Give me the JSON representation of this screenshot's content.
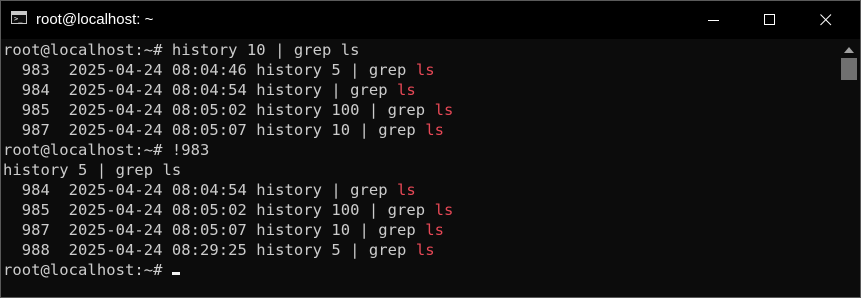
{
  "window": {
    "title": "root@localhost: ~"
  },
  "icons": {
    "app": "terminal-icon",
    "minimize": "minimize-icon",
    "maximize": "maximize-icon",
    "close": "close-icon",
    "scroll_up": "chevron-up-icon"
  },
  "colors": {
    "background": "#0c0c0c",
    "text": "#cccccc",
    "match_highlight": "#e74856",
    "titlebar": "#000000"
  },
  "terminal": {
    "lines": [
      {
        "text": "root@localhost:~# history 10 | grep ls",
        "highlight": ""
      },
      {
        "text": "  983  2025-04-24 08:04:46 history 5 | grep ",
        "highlight": "ls"
      },
      {
        "text": "  984  2025-04-24 08:04:54 history | grep ",
        "highlight": "ls"
      },
      {
        "text": "  985  2025-04-24 08:05:02 history 100 | grep ",
        "highlight": "ls"
      },
      {
        "text": "  987  2025-04-24 08:05:07 history 10 | grep ",
        "highlight": "ls"
      },
      {
        "text": "root@localhost:~# !983",
        "highlight": ""
      },
      {
        "text": "history 5 | grep ls",
        "highlight": ""
      },
      {
        "text": "  984  2025-04-24 08:04:54 history | grep ",
        "highlight": "ls"
      },
      {
        "text": "  985  2025-04-24 08:05:02 history 100 | grep ",
        "highlight": "ls"
      },
      {
        "text": "  987  2025-04-24 08:05:07 history 10 | grep ",
        "highlight": "ls"
      },
      {
        "text": "  988  2025-04-24 08:29:25 history 5 | grep ",
        "highlight": "ls"
      },
      {
        "text": "root@localhost:~# ",
        "highlight": ""
      }
    ]
  }
}
